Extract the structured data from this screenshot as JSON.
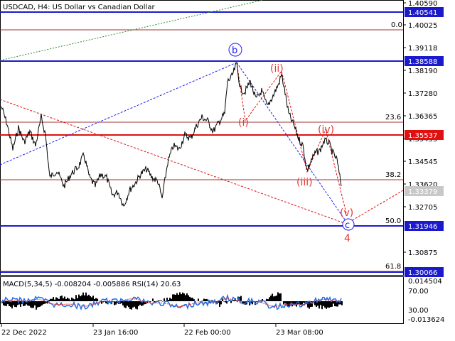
{
  "window": {
    "symbol_title": "USDCAD, H4:  US Dollar vs Canadian Dollar",
    "indicator_title": "MACD(5,34,5) -0.008204 -0.005886 RSI(14) 20.63"
  },
  "price_axis": {
    "ticks": [
      "1.40590",
      "1.40025",
      "1.39118",
      "1.38190",
      "1.37280",
      "1.36365",
      "1.35455",
      "1.34545",
      "1.33620",
      "1.32705",
      "1.30875"
    ],
    "highlighted_levels": [
      {
        "label": "1.40541",
        "color": "#1a1acc"
      },
      {
        "label": "1.38588",
        "color": "#1a1acc"
      },
      {
        "label": "1.35537",
        "color": "#e01010"
      },
      {
        "label": "1.33379",
        "color": "#c8c8c8"
      },
      {
        "label": "1.31946",
        "color": "#1a1acc"
      },
      {
        "label": "1.30066",
        "color": "#1a1acc"
      }
    ]
  },
  "indicator_axis": {
    "ticks": [
      "0.014504",
      "70.00",
      "30.00",
      "-0.013624"
    ]
  },
  "time_axis": {
    "ticks": [
      "22 Dec 2022",
      "23 Jan 16:00",
      "22 Feb 00:00",
      "23 Mar 08:00"
    ]
  },
  "fibonacci": [
    {
      "label": "0.0"
    },
    {
      "label": "23.6"
    },
    {
      "label": "38.2"
    },
    {
      "label": "50.0"
    },
    {
      "label": "61.8"
    }
  ],
  "wave_labels": {
    "b": "b",
    "c": "c",
    "i": "(i)",
    "ii": "(ii)",
    "iii": "(iii)",
    "iv": "(iv)",
    "v": "(v)",
    "four": "4"
  },
  "colors": {
    "price_line": "#000000",
    "fib_line": "#a03030",
    "red_level": "#e01010",
    "blue_level": "#1a1acc",
    "wave_red": "#e53935",
    "wave_blue": "#1a1aff",
    "green_trend": "#2e8b2e",
    "macd_hist": "#000000",
    "rsi_line": "#1e6ee6",
    "signal_line": "#e53935"
  }
}
